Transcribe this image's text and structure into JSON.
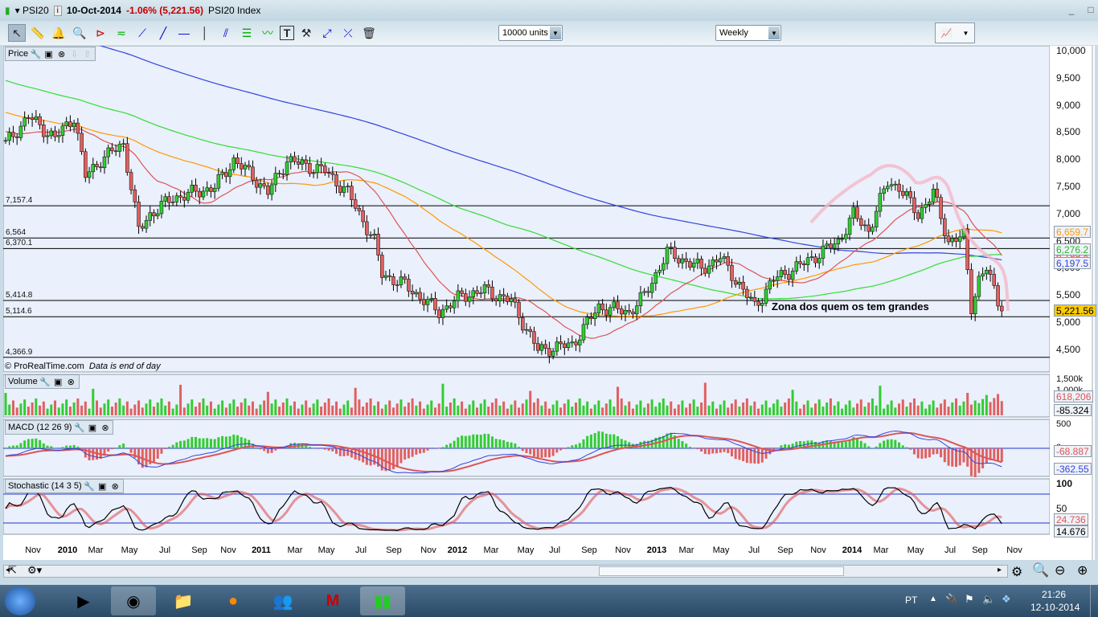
{
  "title": {
    "symbol": "PSI20",
    "date": "10-Oct-2014",
    "change": "-1.06% (5,221.56)",
    "name": "PSI20 Index",
    "minimize": "_",
    "restore": "□"
  },
  "toolbar": {
    "units": "10000 units",
    "period": "Weekly",
    "tools": [
      "pointer-icon",
      "ruler-icon",
      "alarm-bell-icon",
      "zoom-magnifier-icon",
      "triangle-pattern-icon",
      "channel-icon",
      "segment-icon",
      "line-icon",
      "horizontal-line-icon",
      "vertical-line-icon",
      "parallel-lines-icon",
      "fibonacci-icon",
      "trendline-icon",
      "text-icon",
      "properties-tools-icon",
      "extend-line-icon",
      "cross-line-icon",
      "trash-icon"
    ]
  },
  "panels": {
    "price": "Price",
    "volume": "Volume",
    "macd": "MACD (12 26 9)",
    "stoch": "Stochastic (14 3 5)"
  },
  "copyright": "© ProRealTime.com",
  "eod": "Data is end of day",
  "annotation": "Zona dos quem os tem grandes",
  "price_axis": [
    "10,000",
    "9,500",
    "9,000",
    "8,500",
    "8,000",
    "7,500",
    "7,000",
    "6,500",
    "6,000",
    "5,500",
    "5,000",
    "4,500"
  ],
  "levels": [
    "7,157.4",
    "6,564",
    "6,370.1",
    "5,414.8",
    "5,114.6",
    "4,366.9"
  ],
  "level_values": [
    7157.4,
    6564,
    6370.1,
    5414.8,
    5114.6,
    4366.9
  ],
  "badges": {
    "ma_orange": "6,659.7",
    "ma_green": "6,276.2",
    "ma_red": "6,199.8",
    "ma_blue": "6,197.5",
    "last": "5,221.56"
  },
  "volume_axis": [
    "1,500k",
    "1,000k"
  ],
  "volume_badges": [
    "618,206",
    "-85.324"
  ],
  "macd_axis": [
    "500",
    "0"
  ],
  "macd_badges": [
    "-68.887",
    "-362.55"
  ],
  "stoch_axis": [
    "100",
    "50"
  ],
  "stoch_badges": [
    "24.736",
    "14.676"
  ],
  "x_labels": [
    "Nov",
    "2010",
    "Mar",
    "May",
    "Jul",
    "Sep",
    "Nov",
    "2011",
    "Mar",
    "May",
    "Jul",
    "Sep",
    "Nov",
    "2012",
    "Mar",
    "May",
    "Jul",
    "Sep",
    "Nov",
    "2013",
    "Mar",
    "May",
    "Jul",
    "Sep",
    "Nov",
    "2014",
    "Mar",
    "May",
    "Jul",
    "Sep",
    "Nov"
  ],
  "price_path": [
    [
      0,
      8300
    ],
    [
      6,
      8800
    ],
    [
      13,
      8400
    ],
    [
      18,
      8800
    ],
    [
      21,
      7700
    ],
    [
      25,
      8000
    ],
    [
      31,
      8300
    ],
    [
      35,
      6700
    ],
    [
      38,
      7000
    ],
    [
      44,
      7300
    ],
    [
      55,
      7500
    ],
    [
      60,
      8000
    ],
    [
      65,
      7700
    ],
    [
      69,
      7400
    ],
    [
      74,
      8000
    ],
    [
      84,
      7800
    ],
    [
      90,
      7400
    ],
    [
      97,
      6500
    ],
    [
      99,
      5900
    ],
    [
      105,
      5700
    ],
    [
      114,
      5200
    ],
    [
      120,
      5500
    ],
    [
      126,
      5600
    ],
    [
      133,
      5400
    ],
    [
      140,
      4500
    ],
    [
      149,
      4600
    ],
    [
      156,
      5300
    ],
    [
      164,
      5200
    ],
    [
      168,
      5500
    ],
    [
      174,
      6300
    ],
    [
      183,
      6000
    ],
    [
      188,
      6200
    ],
    [
      197,
      5300
    ],
    [
      202,
      5800
    ],
    [
      210,
      6100
    ],
    [
      219,
      6500
    ],
    [
      223,
      7000
    ],
    [
      227,
      6700
    ],
    [
      232,
      7600
    ],
    [
      235,
      7500
    ],
    [
      240,
      7000
    ],
    [
      244,
      7400
    ],
    [
      248,
      6500
    ],
    [
      252,
      6600
    ],
    [
      254,
      5300
    ],
    [
      256,
      5800
    ],
    [
      258,
      6000
    ],
    [
      262,
      5221.56
    ]
  ],
  "taskbar": {
    "lang": "PT",
    "time": "21:26",
    "date": "12-10-2014"
  },
  "colors": {
    "up": "#33cc33",
    "down": "#e06060",
    "ma_blue": "#3344dd",
    "ma_green": "#33dd33",
    "ma_orange": "#ff9900",
    "ma_red": "#dd5555",
    "last_badge": "#ffcc00"
  }
}
